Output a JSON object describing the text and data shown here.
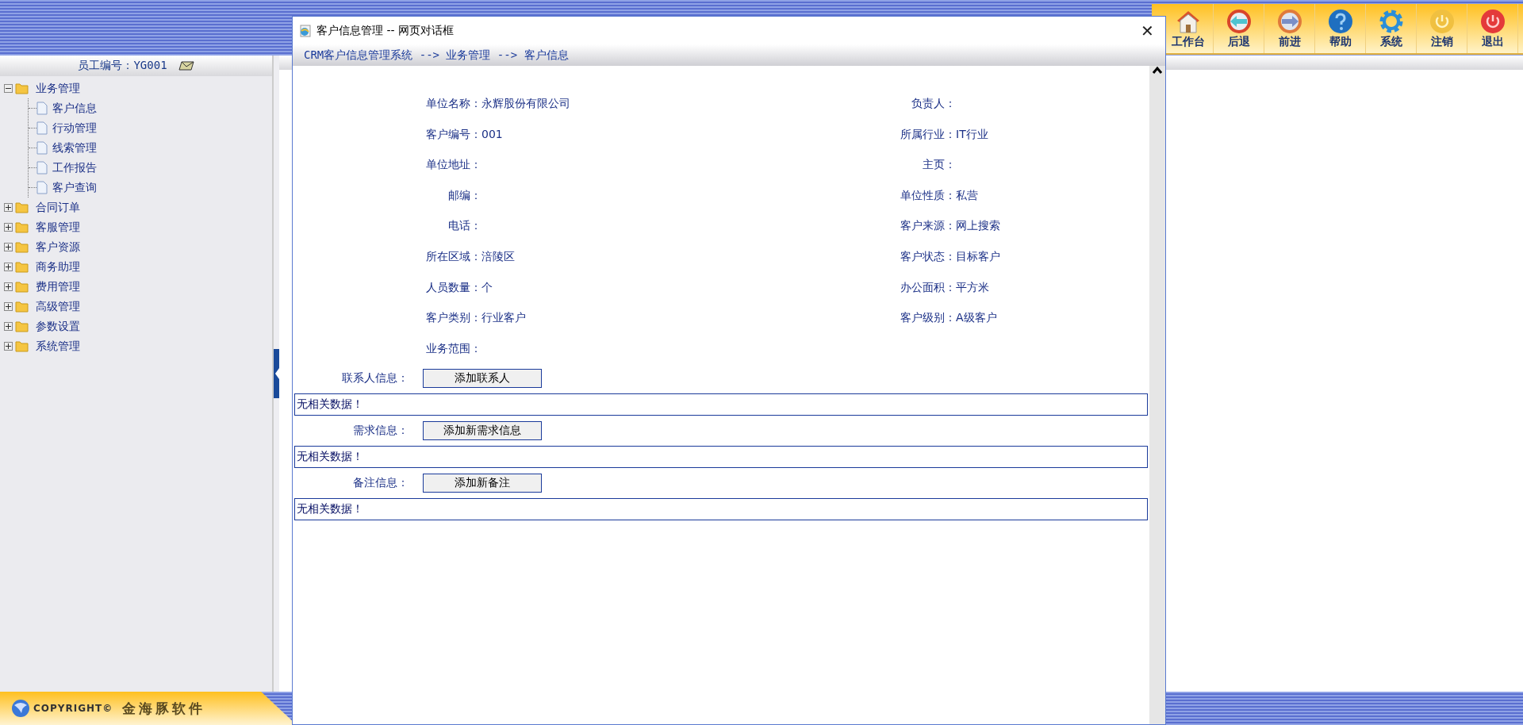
{
  "toolbar": [
    {
      "label": "工作台"
    },
    {
      "label": "后退"
    },
    {
      "label": "前进"
    },
    {
      "label": "帮助"
    },
    {
      "label": "系统"
    },
    {
      "label": "注销"
    },
    {
      "label": "退出"
    }
  ],
  "sidebar": {
    "employee_label": "员工编号：YG001",
    "tree": [
      {
        "label": "业务管理",
        "expanded": true,
        "children": [
          {
            "label": "客户信息"
          },
          {
            "label": "行动管理"
          },
          {
            "label": "线索管理"
          },
          {
            "label": "工作报告"
          },
          {
            "label": "客户查询"
          }
        ]
      },
      {
        "label": "合同订单",
        "expanded": false
      },
      {
        "label": "客服管理",
        "expanded": false
      },
      {
        "label": "客户资源",
        "expanded": false
      },
      {
        "label": "商务助理",
        "expanded": false
      },
      {
        "label": "费用管理",
        "expanded": false
      },
      {
        "label": "高级管理",
        "expanded": false
      },
      {
        "label": "参数设置",
        "expanded": false
      },
      {
        "label": "系统管理",
        "expanded": false
      }
    ]
  },
  "footer": {
    "copyright": "COPYRIGHT©",
    "company": "金海豚软件"
  },
  "dialog": {
    "title": "客户信息管理 -- 网页对话框",
    "close": "✕",
    "breadcrumb": "CRM客户信息管理系统 --> 业务管理 --> 客户信息",
    "rows": [
      {
        "left": {
          "label": "单位名称：",
          "value": "永辉股份有限公司"
        },
        "right": {
          "label": "负责人："
        }
      },
      {
        "left": {
          "label": "客户编号：",
          "value": "001"
        },
        "right": {
          "label": "所属行业：",
          "value": "IT行业"
        }
      },
      {
        "left": {
          "label": "单位地址："
        },
        "right": {
          "label": "主页："
        }
      },
      {
        "left": {
          "label": "邮编："
        },
        "right": {
          "label": "单位性质：",
          "value": "私营"
        }
      },
      {
        "left": {
          "label": "电话："
        },
        "right": {
          "label": "客户来源：",
          "value": "网上搜索"
        }
      },
      {
        "left": {
          "label": "所在区域：",
          "value": "涪陵区"
        },
        "right": {
          "label": "客户状态：",
          "value": "目标客户"
        }
      },
      {
        "left": {
          "label": "人员数量：",
          "value": "个"
        },
        "right": {
          "label": "办公面积：",
          "value": "平方米"
        }
      },
      {
        "left": {
          "label": "客户类别：",
          "value": "行业客户"
        },
        "right": {
          "label": "客户级别：",
          "value": "A级客户"
        }
      },
      {
        "left": {
          "label": "业务范围："
        }
      }
    ],
    "sections": [
      {
        "label": "联系人信息：",
        "button": "添加联系人",
        "empty": "无相关数据！"
      },
      {
        "label": "需求信息：",
        "button": "添加新需求信息",
        "empty": "无相关数据！"
      },
      {
        "label": "备注信息：",
        "button": "添加新备注",
        "empty": "无相关数据！"
      }
    ]
  }
}
